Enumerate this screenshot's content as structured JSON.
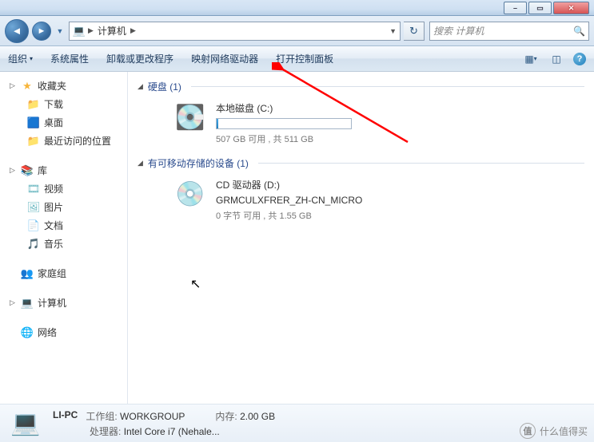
{
  "titlebar": {
    "min": "–",
    "max": "▭",
    "close": "✕"
  },
  "nav": {
    "crumb_label": "计算机",
    "search_placeholder": "搜索 计算机"
  },
  "toolbar": {
    "items": [
      {
        "label": "组织",
        "has_drop": true
      },
      {
        "label": "系统属性"
      },
      {
        "label": "卸载或更改程序"
      },
      {
        "label": "映射网络驱动器"
      },
      {
        "label": "打开控制面板"
      }
    ]
  },
  "sidebar": {
    "groups": [
      {
        "heading": "收藏夹",
        "icon": "★",
        "icon_cls": "ico-star",
        "caret": "▷",
        "items": [
          {
            "label": "下载",
            "icon": "📁",
            "icon_cls": "ico-folder"
          },
          {
            "label": "桌面",
            "icon": "🟦",
            "icon_cls": "ico-computer"
          },
          {
            "label": "最近访问的位置",
            "icon": "📁",
            "icon_cls": "ico-folder"
          }
        ]
      },
      {
        "heading": "库",
        "icon": "📚",
        "icon_cls": "ico-lib",
        "caret": "▷",
        "items": [
          {
            "label": "视频",
            "icon": "🎞",
            "icon_cls": "ico-lib"
          },
          {
            "label": "图片",
            "icon": "🖼",
            "icon_cls": "ico-lib"
          },
          {
            "label": "文档",
            "icon": "📄",
            "icon_cls": "ico-lib"
          },
          {
            "label": "音乐",
            "icon": "🎵",
            "icon_cls": "ico-lib"
          }
        ]
      },
      {
        "heading": "家庭组",
        "icon": "👥",
        "icon_cls": "ico-home",
        "caret": "",
        "items": []
      },
      {
        "heading": "计算机",
        "icon": "💻",
        "icon_cls": "ico-computer",
        "caret": "▷",
        "selected": true,
        "items": []
      },
      {
        "heading": "网络",
        "icon": "🌐",
        "icon_cls": "ico-network",
        "caret": "",
        "items": []
      }
    ]
  },
  "main": {
    "sections": [
      {
        "title": "硬盘 (1)",
        "drives": [
          {
            "name": "本地磁盘 (C:)",
            "sub": "507 GB 可用 , 共 511 GB",
            "icon": "💽",
            "icon_cls": "ico-drive",
            "bar": true
          }
        ]
      },
      {
        "title": "有可移动存储的设备 (1)",
        "drives": [
          {
            "name": "CD 驱动器 (D:)",
            "line2": "GRMCULXFRER_ZH-CN_MICRO",
            "sub": "0 字节 可用 , 共 1.55 GB",
            "icon": "💿",
            "icon_cls": "ico-disc",
            "bar": false
          }
        ]
      }
    ]
  },
  "status": {
    "pc_name": "LI-PC",
    "row1_col1_label": "工作组:",
    "row1_col1_val": "WORKGROUP",
    "row1_col2_label": "内存:",
    "row1_col2_val": "2.00 GB",
    "row2_label": "处理器:",
    "row2_val": "Intel Core i7 (Nehale..."
  },
  "watermark": {
    "icon": "值",
    "text": "什么值得买"
  }
}
